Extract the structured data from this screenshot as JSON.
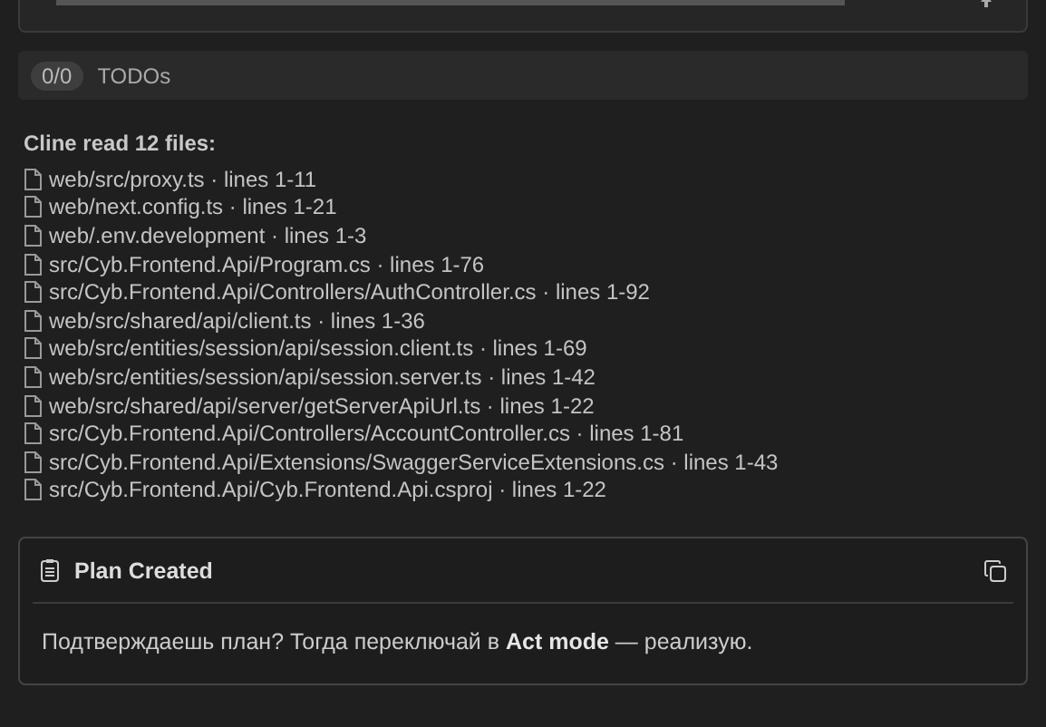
{
  "todos": {
    "count": "0/0",
    "label": "TODOs"
  },
  "files_read": {
    "title": "Cline read 12 files:",
    "files": [
      "web/src/proxy.ts · lines 1-11",
      "web/next.config.ts · lines 1-21",
      "web/.env.development · lines 1-3",
      "src/Cyb.Frontend.Api/Program.cs · lines 1-76",
      "src/Cyb.Frontend.Api/Controllers/AuthController.cs · lines 1-92",
      "web/src/shared/api/client.ts · lines 1-36",
      "web/src/entities/session/api/session.client.ts · lines 1-69",
      "web/src/entities/session/api/session.server.ts · lines 1-42",
      "web/src/shared/api/server/getServerApiUrl.ts · lines 1-22",
      "src/Cyb.Frontend.Api/Controllers/AccountController.cs · lines 1-81",
      "src/Cyb.Frontend.Api/Extensions/SwaggerServiceExtensions.cs · lines 1-43",
      "src/Cyb.Frontend.Api/Cyb.Frontend.Api.csproj · lines 1-22"
    ]
  },
  "plan": {
    "title": "Plan Created",
    "text": "Подтверждаешь план? Тогда переключай в **Act mode** — реализую."
  }
}
